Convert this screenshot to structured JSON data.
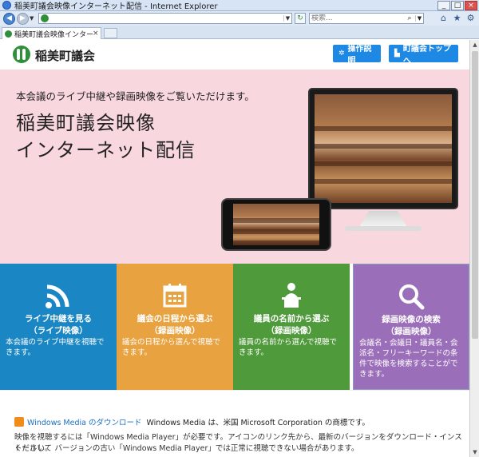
{
  "window": {
    "title": "稲美町議会映像インターネット配信 - Internet Explorer",
    "controls": [
      "_",
      "□",
      "×"
    ]
  },
  "addressbar": {
    "url": "",
    "search_placeholder": "検索..."
  },
  "tab": {
    "label": "稲美町議会映像インターネ...",
    "close": "×"
  },
  "header": {
    "logo": "稲美町議会",
    "manual_button": "操作説明",
    "top_button": "町議会トップへ"
  },
  "hero": {
    "lead": "本会議のライブ中継や録画映像をご覧いただけます。",
    "title_line1": "稲美町議会映像",
    "title_line2": "インターネット配信"
  },
  "tiles": [
    {
      "title": "ライブ中継を見る",
      "sub": "（ライブ映像）",
      "desc": "本会議のライブ中継を視聴できます。",
      "color": "#1b86c4",
      "icon": "wifi-icon"
    },
    {
      "title": "議会の日程から選ぶ",
      "sub": "（録画映像）",
      "desc": "議会の日程から選んで視聴できます。",
      "color": "#e8a23f",
      "icon": "calendar-icon"
    },
    {
      "title": "議員の名前から選ぶ",
      "sub": "（録画映像）",
      "desc": "議員の名前から選んで視聴できます。",
      "color": "#4f9a3a",
      "icon": "speaker-podium-icon"
    },
    {
      "title": "録画映像の検索",
      "sub": "（録画映像）",
      "desc": "会議名・会議日・議員名・会派名・フリーキーワードの条件で映像を検索することができます。",
      "color": "#9b6eb9",
      "icon": "search-icon"
    }
  ],
  "note": {
    "wm_link": "Windows Media のダウンロード",
    "wm_text": "Windows Media は、米国 Microsoft Corporation の商標です。",
    "line2": "映像を視聴するには「Windows Media Player」が必要です。アイコンのリンク先から、最新のバージョンをダウンロード・インストールして",
    "line3": "ください。 バージョンの古い「Windows Media Player」では正常に視聴できない場合があります。"
  }
}
